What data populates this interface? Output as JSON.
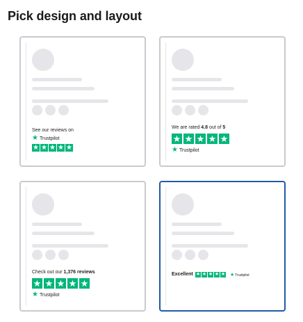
{
  "page": {
    "title": "Pick design and layout"
  },
  "brand": {
    "accent": "#00b67a",
    "selected_border": "#1f5aa8",
    "placeholder": "#e6e6ea"
  },
  "cards": [
    {
      "selected": false,
      "text_before": "See our reviews on",
      "trustpilot_label": "Trustpilot",
      "star_count": 5
    },
    {
      "selected": false,
      "text_before": "We are rated ",
      "rating": "4.8",
      "text_middle": " out of ",
      "rating_max": "5",
      "star_count": 5,
      "trustpilot_label": "Trustpilot"
    },
    {
      "selected": false,
      "text_before": "Check out our ",
      "review_count": "1,376 reviews",
      "star_count": 5,
      "trustpilot_label": "Trustpilot"
    },
    {
      "selected": true,
      "rating_word": "Excellent",
      "star_count": 5,
      "trustpilot_label": "Trustpilot"
    }
  ]
}
